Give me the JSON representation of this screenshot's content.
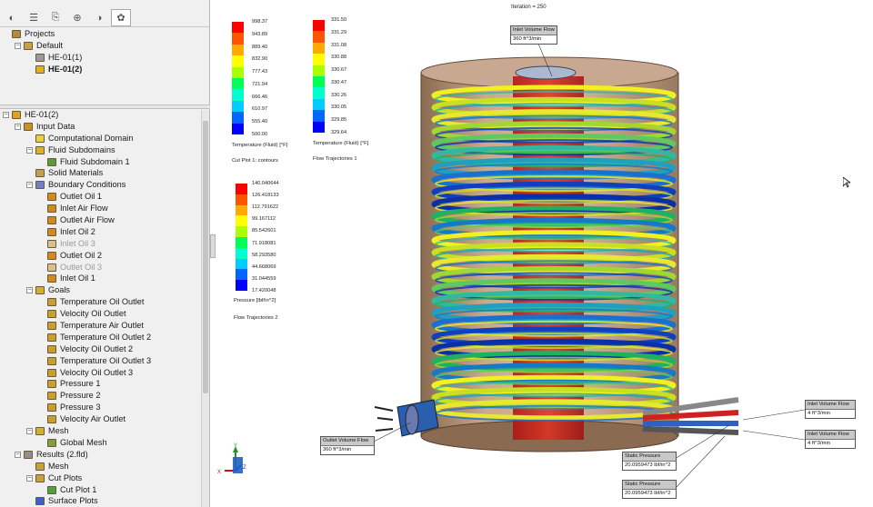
{
  "sidebar": {
    "tabs": [
      {
        "icon": "feature-manager-icon",
        "glyph": "◐"
      },
      {
        "icon": "property-manager-icon",
        "glyph": "☰"
      },
      {
        "icon": "configuration-manager-icon",
        "glyph": "⎘"
      },
      {
        "icon": "dimxpert-icon",
        "glyph": "⊕"
      },
      {
        "icon": "display-manager-icon",
        "glyph": "◑"
      },
      {
        "icon": "flow-simulation-icon",
        "glyph": "✿"
      }
    ],
    "projects": [
      {
        "label": "Projects",
        "level": 0,
        "exp": "",
        "icon": "projects-folder-icon",
        "color": "#b58a3a"
      },
      {
        "label": "Default",
        "level": 1,
        "exp": "−",
        "icon": "configuration-icon",
        "color": "#c8a040"
      },
      {
        "label": "HE-01(1)",
        "level": 2,
        "exp": "",
        "icon": "project-icon",
        "color": "#9a9a9a"
      },
      {
        "label": "HE-01(2)",
        "level": 2,
        "exp": "",
        "icon": "active-project-icon",
        "color": "#e0b020",
        "bold": true
      }
    ],
    "tree": [
      {
        "label": "HE-01(2)",
        "level": 0,
        "exp": "−",
        "icon": "project-icon",
        "color": "#e0a020"
      },
      {
        "label": "Input Data",
        "level": 1,
        "exp": "−",
        "icon": "input-data-icon",
        "color": "#c9902a"
      },
      {
        "label": "Computational Domain",
        "level": 2,
        "exp": "",
        "icon": "computational-domain-icon",
        "color": "#e8d040"
      },
      {
        "label": "Fluid Subdomains",
        "level": 2,
        "exp": "−",
        "icon": "fluid-subdomains-icon",
        "color": "#d8b030"
      },
      {
        "label": "Fluid Subdomain 1",
        "level": 3,
        "exp": "",
        "icon": "fluid-subdomain-icon",
        "color": "#5a9a40"
      },
      {
        "label": "Solid Materials",
        "level": 2,
        "exp": "",
        "icon": "solid-materials-icon",
        "color": "#c0a050"
      },
      {
        "label": "Boundary Conditions",
        "level": 2,
        "exp": "−",
        "icon": "boundary-conditions-icon",
        "color": "#7080c0"
      },
      {
        "label": "Outlet Oil 1",
        "level": 3,
        "exp": "",
        "icon": "boundary-condition-icon",
        "color": "#d08a20"
      },
      {
        "label": "Inlet Air Flow",
        "level": 3,
        "exp": "",
        "icon": "boundary-condition-icon",
        "color": "#d08a20"
      },
      {
        "label": "Outlet Air Flow",
        "level": 3,
        "exp": "",
        "icon": "boundary-condition-icon",
        "color": "#d08a20"
      },
      {
        "label": "Inlet Oil 2",
        "level": 3,
        "exp": "",
        "icon": "boundary-condition-icon",
        "color": "#d08a20"
      },
      {
        "label": "Inlet Oil 3",
        "level": 3,
        "exp": "",
        "icon": "boundary-condition-icon",
        "color": "#d8c090",
        "dim": true
      },
      {
        "label": "Outlet Oil 2",
        "level": 3,
        "exp": "",
        "icon": "boundary-condition-icon",
        "color": "#d08a20"
      },
      {
        "label": "Outlet Oil 3",
        "level": 3,
        "exp": "",
        "icon": "boundary-condition-icon",
        "color": "#d8c090",
        "dim": true
      },
      {
        "label": "Inlet Oil 1",
        "level": 3,
        "exp": "",
        "icon": "boundary-condition-icon",
        "color": "#d08a20"
      },
      {
        "label": "Goals",
        "level": 2,
        "exp": "−",
        "icon": "goals-icon",
        "color": "#d0b030"
      },
      {
        "label": "Temperature Oil Outlet",
        "level": 3,
        "exp": "",
        "icon": "goal-icon",
        "color": "#c8a030"
      },
      {
        "label": "Velocity Oil Outlet",
        "level": 3,
        "exp": "",
        "icon": "goal-icon",
        "color": "#c8a030"
      },
      {
        "label": "Temperature Air Outlet",
        "level": 3,
        "exp": "",
        "icon": "goal-icon",
        "color": "#c8a030"
      },
      {
        "label": "Temperature Oil Outlet 2",
        "level": 3,
        "exp": "",
        "icon": "goal-icon",
        "color": "#c8a030"
      },
      {
        "label": "Velocity Oil Outlet 2",
        "level": 3,
        "exp": "",
        "icon": "goal-icon",
        "color": "#c8a030"
      },
      {
        "label": "Temperature Oil Outlet 3",
        "level": 3,
        "exp": "",
        "icon": "goal-icon",
        "color": "#c8a030"
      },
      {
        "label": "Velocity Oil Outlet 3",
        "level": 3,
        "exp": "",
        "icon": "goal-icon",
        "color": "#c8a030"
      },
      {
        "label": "Pressure 1",
        "level": 3,
        "exp": "",
        "icon": "goal-icon",
        "color": "#c8a030"
      },
      {
        "label": "Pressure 2",
        "level": 3,
        "exp": "",
        "icon": "goal-icon",
        "color": "#c8a030"
      },
      {
        "label": "Pressure 3",
        "level": 3,
        "exp": "",
        "icon": "goal-icon",
        "color": "#c8a030"
      },
      {
        "label": "Velocity Air Outlet",
        "level": 3,
        "exp": "",
        "icon": "goal-icon",
        "color": "#c8a030"
      },
      {
        "label": "Mesh",
        "level": 2,
        "exp": "−",
        "icon": "mesh-icon",
        "color": "#d0b030"
      },
      {
        "label": "Global Mesh",
        "level": 3,
        "exp": "",
        "icon": "global-mesh-icon",
        "color": "#80a040"
      },
      {
        "label": "Results (2.fld)",
        "level": 1,
        "exp": "−",
        "icon": "results-icon",
        "color": "#909090"
      },
      {
        "label": "Mesh",
        "level": 2,
        "exp": "",
        "icon": "results-mesh-icon",
        "color": "#c8a040"
      },
      {
        "label": "Cut Plots",
        "level": 2,
        "exp": "−",
        "icon": "cut-plots-icon",
        "color": "#c8a040"
      },
      {
        "label": "Cut Plot 1",
        "level": 3,
        "exp": "",
        "icon": "cut-plot-icon",
        "color": "#50a040"
      },
      {
        "label": "Surface Plots",
        "level": 2,
        "exp": "",
        "icon": "surface-plots-icon",
        "color": "#4060c0"
      }
    ]
  },
  "viewport": {
    "iteration": "Iteration = 250",
    "legend_colors": [
      "#ff0000",
      "#ff5500",
      "#ffaa00",
      "#ffff00",
      "#aaff00",
      "#00ff55",
      "#00ffcc",
      "#00ccff",
      "#0066ff",
      "#0000ff"
    ],
    "legends": [
      {
        "values": [
          "998.37",
          "943.89",
          "889.40",
          "832.90",
          "777.43",
          "721.94",
          "666.46",
          "610.97",
          "555.40",
          "500.00"
        ],
        "title": "Temperature (Fluid) [°F]",
        "caption": "Cut Plot 1: contours"
      },
      {
        "values": [
          "331.50",
          "331.29",
          "331.08",
          "330.88",
          "330.67",
          "330.47",
          "330.26",
          "330.05",
          "329.85",
          "329.64"
        ],
        "title": "Temperature (Fluid) [°F]",
        "caption": "Flow Trajectories 1"
      },
      {
        "values": [
          "140.040644",
          "126.418133",
          "112.791622",
          "99.167112",
          "85.542601",
          "71.918081",
          "58.293580",
          "44.668069",
          "31.044559",
          "17.420048"
        ],
        "title": "Pressure [lbf/in^2]",
        "caption": "Flow Trajectories 2"
      }
    ],
    "callouts": [
      {
        "name": "inlet-volume-flow-top",
        "header": "Inlet Volume Flow",
        "value": "360 ft^3/min"
      },
      {
        "name": "outlet-volume-flow",
        "header": "Outlet Volume Flow",
        "value": "360 ft^3/min"
      },
      {
        "name": "inlet-volume-flow-right-1",
        "header": "Inlet Volume Flow",
        "value": "4 ft^3/min"
      },
      {
        "name": "inlet-volume-flow-right-2",
        "header": "Inlet Volume Flow",
        "value": "4 ft^3/min"
      },
      {
        "name": "static-pressure-1",
        "header": "Static Pressure",
        "value": "20.0959473 lbf/in^2"
      },
      {
        "name": "static-pressure-2",
        "header": "Static Pressure",
        "value": "20.0959473 lbf/in^2"
      }
    ],
    "triad": {
      "x": "X",
      "y": "Y",
      "z": "Z"
    }
  }
}
